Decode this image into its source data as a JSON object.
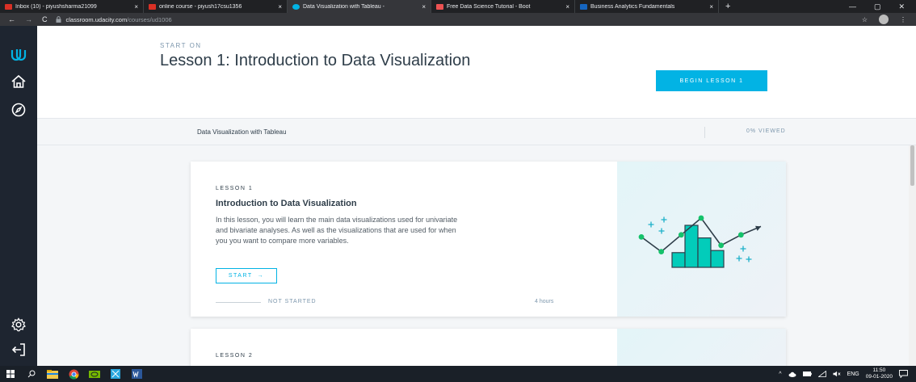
{
  "browser": {
    "tabs": [
      {
        "title": "Inbox (10) - piyushsharma21099",
        "favicon_color": "#d93025",
        "active": false
      },
      {
        "title": "online course - piyush17csu1356",
        "favicon_color": "#d93025",
        "active": false
      },
      {
        "title": "Data Visualization with Tableau -",
        "favicon_color": "#02b3e4",
        "active": true
      },
      {
        "title": "Free Data Science Tutorial - Boot",
        "favicon_color": "#ec5252",
        "active": false
      },
      {
        "title": "Business Analytics Fundamentals",
        "favicon_color": "#1565c0",
        "active": false
      }
    ],
    "tab_close": "×",
    "new_tab": "+",
    "window_controls": {
      "minimize": "—",
      "maximize": "▢",
      "close": "✕"
    },
    "nav": {
      "back": "←",
      "forward": "→",
      "reload": "C"
    },
    "url_host": "classroom.udacity.com",
    "url_path": "/courses/ud1006",
    "star": "☆",
    "menu": "⋮"
  },
  "header": {
    "start_on": "START ON",
    "title": "Lesson 1: Introduction to Data Visualization",
    "begin_label": "BEGIN LESSON 1"
  },
  "subbar": {
    "course_name": "Data Visualization with Tableau",
    "viewed": "0% VIEWED"
  },
  "lessons": [
    {
      "label": "LESSON 1",
      "title": "Introduction to Data Visualization",
      "desc_lines": [
        "In this lesson, you will learn the main data visualizations used for univariate",
        "and bivariate analyses. As well as the visualizations that are used for when",
        "you you want to compare more variables."
      ],
      "start_label": "START",
      "start_arrow": "→",
      "status": "NOT STARTED",
      "duration": "4 hours",
      "illustration": {
        "bars": [
          0.35,
          1.0,
          0.7,
          0.4
        ],
        "line": [
          0.55,
          0.2,
          0.6,
          1.0,
          0.35,
          0.6,
          0.8
        ]
      }
    },
    {
      "label": "LESSON 2"
    }
  ],
  "taskbar": {
    "tray_lang": "ENG",
    "time": "11:50",
    "date": "09-01-2020"
  },
  "colors": {
    "accent": "#02b3e4",
    "teal": "#15c26b",
    "bar": "#02ccba",
    "dark_text": "#2e3d49"
  }
}
